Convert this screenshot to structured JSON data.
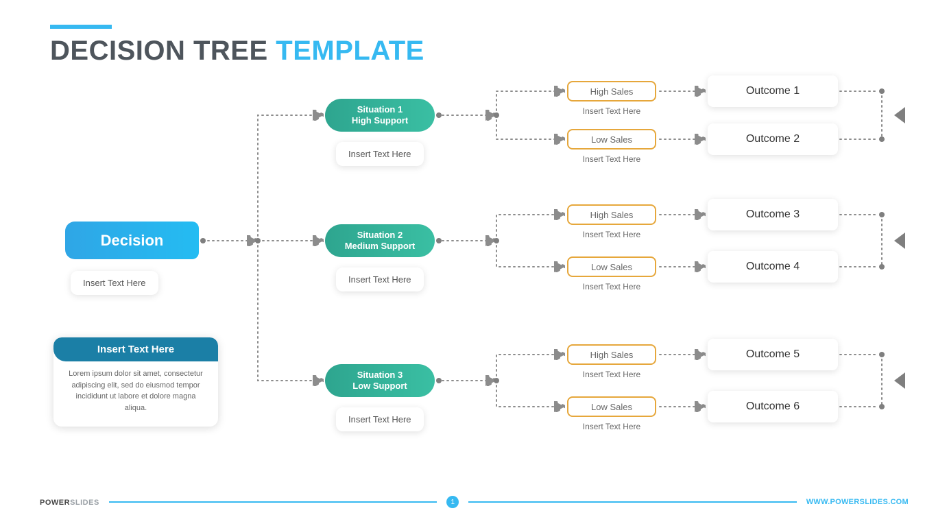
{
  "title": {
    "dark": "DECISION TREE",
    "blue": "TEMPLATE"
  },
  "decision": {
    "label": "Decision",
    "sub": "Insert Text Here"
  },
  "info": {
    "head": "Insert Text Here",
    "body": "Lorem ipsum dolor sit amet, consectetur adipiscing elit, sed do eiusmod tempor incididunt ut labore et dolore magna aliqua."
  },
  "situations": [
    {
      "line1": "Situation 1",
      "line2": "High Support",
      "sub": "Insert Text Here"
    },
    {
      "line1": "Situation 2",
      "line2": "Medium Support",
      "sub": "Insert Text Here"
    },
    {
      "line1": "Situation 3",
      "line2": "Low Support",
      "sub": "Insert Text Here"
    }
  ],
  "sales": {
    "high": "High Sales",
    "low": "Low Sales",
    "sub": "Insert Text Here"
  },
  "outcomes": [
    "Outcome 1",
    "Outcome 2",
    "Outcome 3",
    "Outcome 4",
    "Outcome 5",
    "Outcome 6"
  ],
  "footer": {
    "brand_bold": "POWER",
    "brand_light": "SLIDES",
    "page": "1",
    "url": "WWW.POWERSLIDES.COM"
  }
}
